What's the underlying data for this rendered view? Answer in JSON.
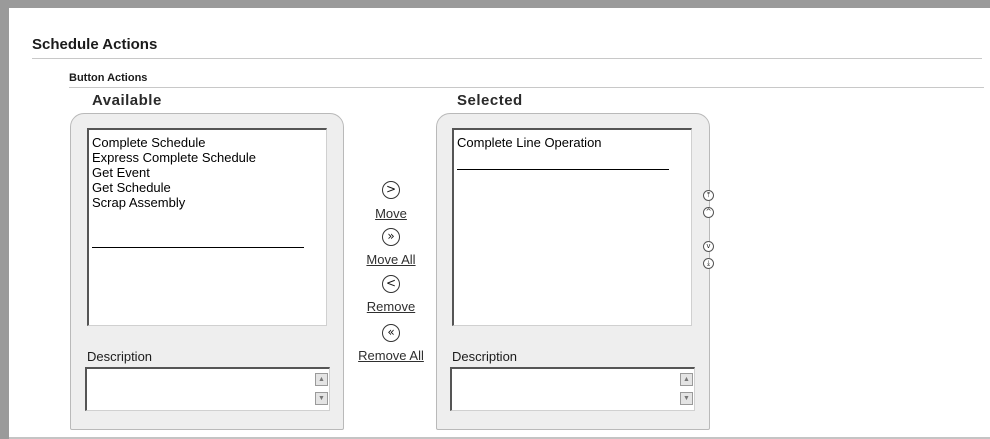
{
  "section": {
    "title": "Schedule Actions"
  },
  "subsection": {
    "title": "Button Actions"
  },
  "available": {
    "header": "Available",
    "items": [
      "Complete Schedule",
      "Express Complete Schedule",
      "Get Event",
      "Get Schedule",
      "Scrap Assembly"
    ],
    "description_label": "Description"
  },
  "selected": {
    "header": "Selected",
    "items": [
      "Complete Line Operation"
    ],
    "description_label": "Description"
  },
  "shuttle": {
    "move": "Move",
    "move_all": "Move All",
    "remove": "Remove",
    "remove_all": "Remove All"
  },
  "icons": {
    "move": "chevron-right-circle-icon",
    "move_all": "double-chevron-right-circle-icon",
    "remove": "chevron-left-circle-icon",
    "remove_all": "double-chevron-left-circle-icon",
    "reorder_top": "move-to-top-icon",
    "reorder_up": "move-up-icon",
    "reorder_down": "move-down-icon",
    "reorder_bottom": "move-to-bottom-icon"
  },
  "colors": {
    "frame": "#9a9a9a",
    "panel": "#eeeeee"
  }
}
